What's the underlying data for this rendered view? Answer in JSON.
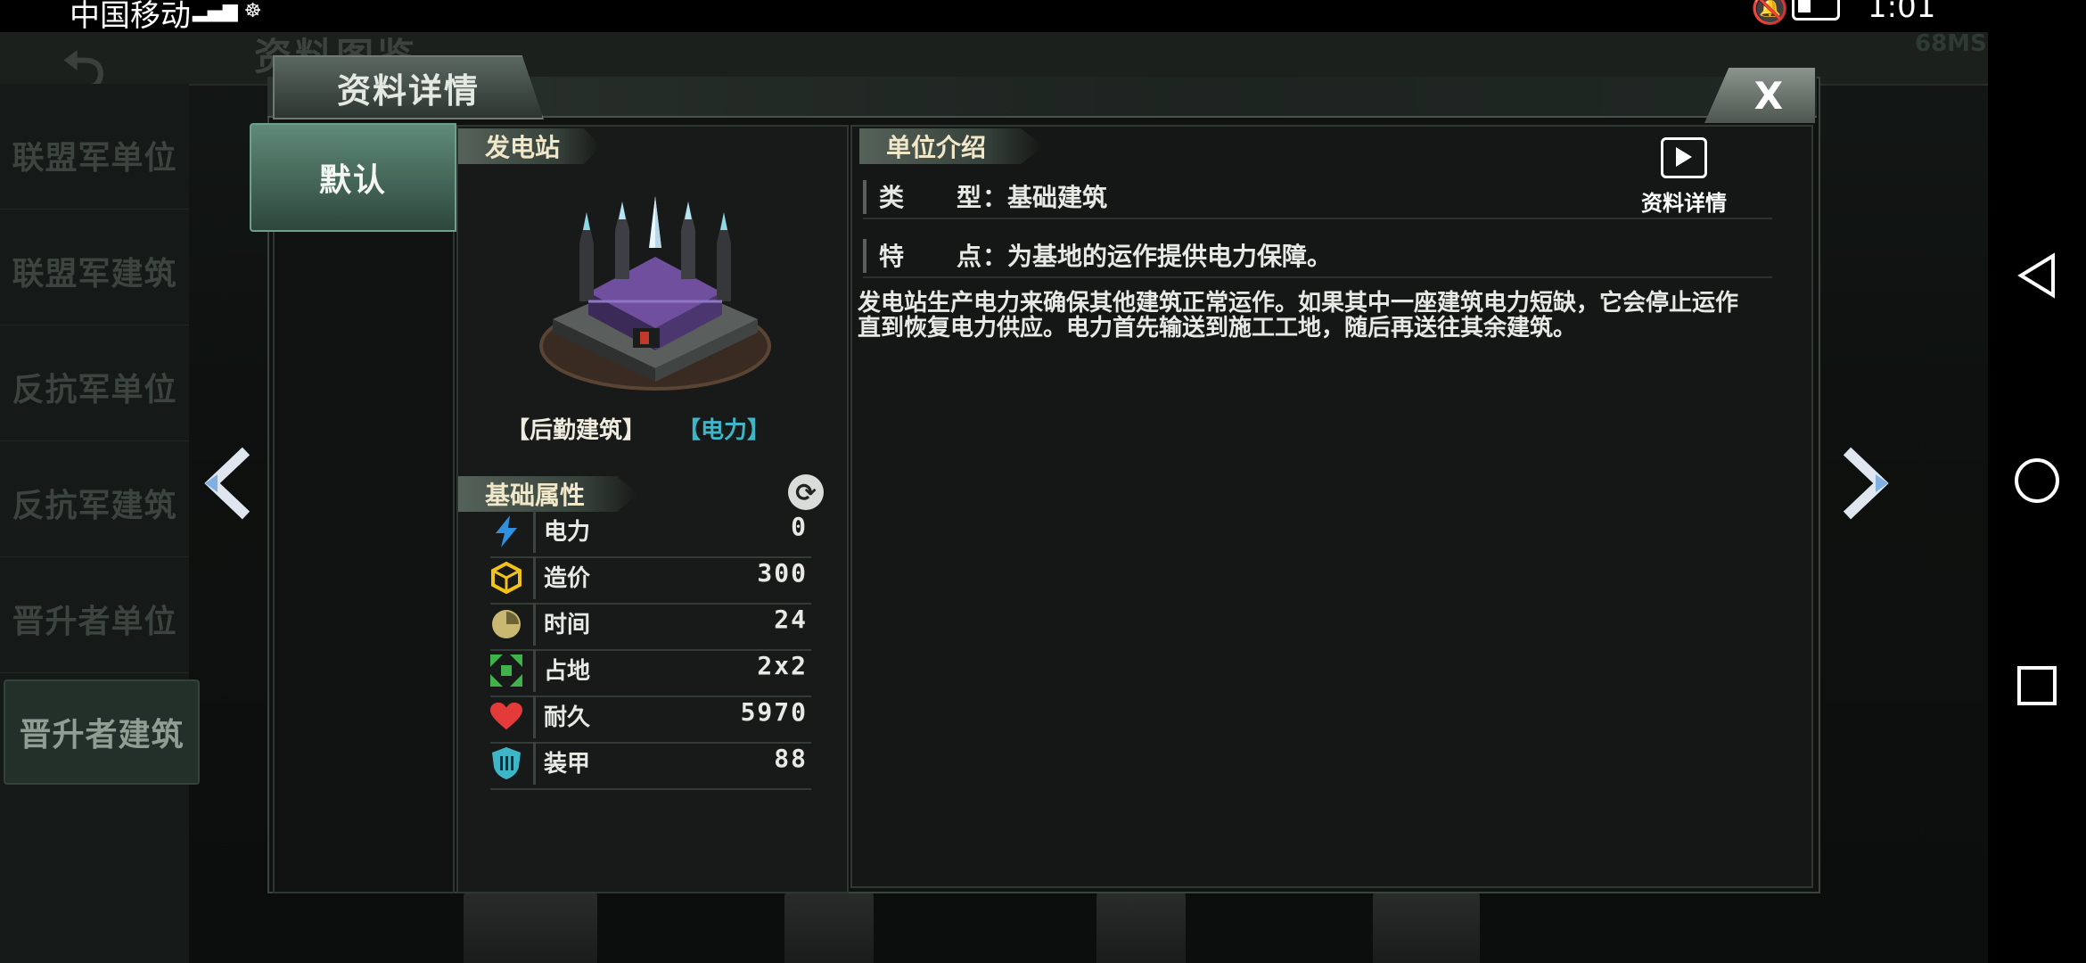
{
  "status_bar": {
    "carrier": "中国移动",
    "time": "1:01"
  },
  "background": {
    "title": "资料图鉴",
    "fps": "68MS",
    "sidebar": [
      {
        "label": "联盟军单位"
      },
      {
        "label": "联盟军建筑"
      },
      {
        "label": "反抗军单位"
      },
      {
        "label": "反抗军建筑"
      },
      {
        "label": "晋升者单位"
      },
      {
        "label": "晋升者建筑"
      }
    ]
  },
  "dialog": {
    "title": "资料详情",
    "close_label": "X",
    "default_tab": "默认"
  },
  "unit": {
    "name": "发电站",
    "tag_category": "【后勤建筑】",
    "tag_type": "【电力】",
    "stats_header": "基础属性",
    "stats": [
      {
        "label": "电力",
        "value": "0",
        "icon": "lightning-icon",
        "color": "#2f8fe0"
      },
      {
        "label": "造价",
        "value": "300",
        "icon": "cube-icon",
        "color": "#f2c21b"
      },
      {
        "label": "时间",
        "value": "24",
        "icon": "clock-icon",
        "color": "#c9b872"
      },
      {
        "label": "占地",
        "value": "2x2",
        "icon": "expand-icon",
        "color": "#3fb24a"
      },
      {
        "label": "耐久",
        "value": "5970",
        "icon": "heart-icon",
        "color": "#e53a3a"
      },
      {
        "label": "装甲",
        "value": "88",
        "icon": "shield-icon",
        "color": "#3fb6c8"
      }
    ]
  },
  "info": {
    "header": "单位介绍",
    "detail_button": "资料详情",
    "type_key": "类　　型：",
    "type_value": "基础建筑",
    "feature_key": "特　　点：",
    "feature_value": "为基地的运作提供电力保障。",
    "description": "发电站生产电力来确保其他建筑正常运作。如果其中一座建筑电力短缺，它会停止运作直到恢复电力供应。电力首先输送到施工工地，随后再送往其余建筑。"
  }
}
